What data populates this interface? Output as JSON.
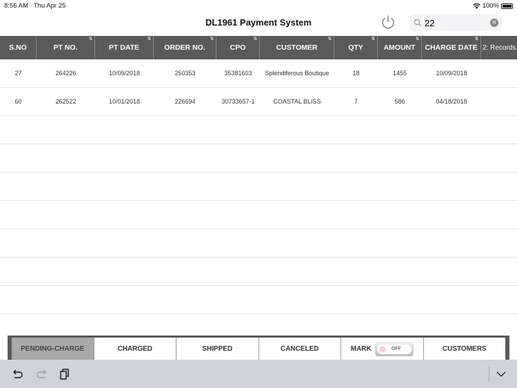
{
  "status_bar": {
    "time": "8:56 AM",
    "date": "Thu Apr 25",
    "battery": "100%"
  },
  "header": {
    "title": "DL1961 Payment System",
    "search_value": "22"
  },
  "table": {
    "columns": [
      {
        "label": "S.NO",
        "sortable": false
      },
      {
        "label": "PT NO.",
        "sortable": true
      },
      {
        "label": "PT DATE",
        "sortable": true
      },
      {
        "label": "ORDER NO.",
        "sortable": true
      },
      {
        "label": "CPO",
        "sortable": true
      },
      {
        "label": "CUSTOMER",
        "sortable": true
      },
      {
        "label": "QTY",
        "sortable": true
      },
      {
        "label": "AMOUNT",
        "sortable": true
      },
      {
        "label": "CHARGE DATE",
        "sortable": true
      }
    ],
    "records_label": "2: Records",
    "rows": [
      [
        "27",
        "264226",
        "10/09/2018",
        "250353",
        "35381603",
        "Splendiferous Boutique",
        "18",
        "1455",
        "10/09/2018"
      ],
      [
        "60",
        "262522",
        "10/01/2018",
        "226694",
        "30733657-1",
        "COASTAL BLISS",
        "7",
        "586",
        "04/18/2018"
      ]
    ]
  },
  "tabs": [
    {
      "label": "PENDING-CHARGE",
      "active": true
    },
    {
      "label": "CHARGED"
    },
    {
      "label": "SHIPPED"
    },
    {
      "label": "CANCELED"
    },
    {
      "label": "MARK",
      "toggle": "OFF"
    },
    {
      "label": "CUSTOMERS"
    }
  ],
  "icons": {
    "power": "power-icon",
    "search": "search-icon",
    "clear": "clear-icon",
    "undo": "undo-icon",
    "redo": "redo-icon",
    "paste": "paste-icon",
    "keyboard_hide": "chevron-down-icon"
  }
}
